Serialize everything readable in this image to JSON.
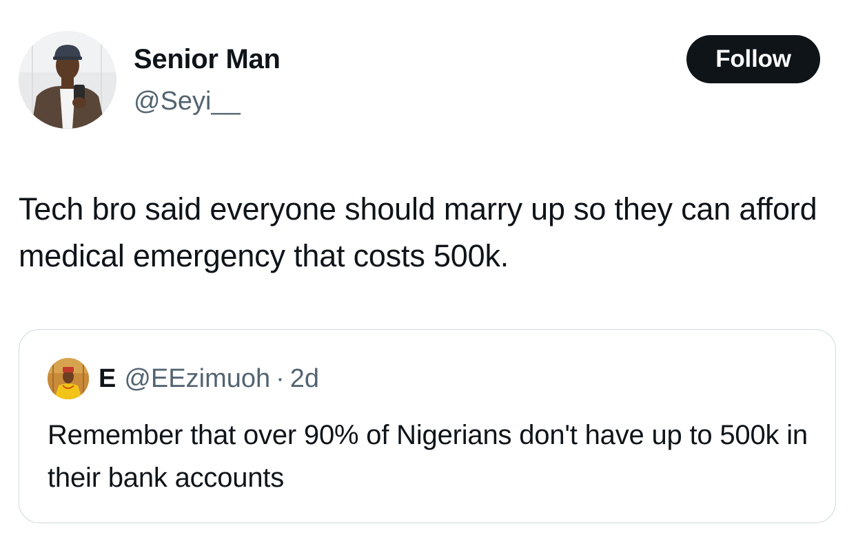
{
  "tweet": {
    "author": {
      "display_name": "Senior Man",
      "handle": "@Seyi__"
    },
    "follow_label": "Follow",
    "text": "Tech bro said everyone should marry up so they can afford medical emergency that costs 500k."
  },
  "quoted_tweet": {
    "author": {
      "display_name": "E",
      "handle": "@EEzimuoh"
    },
    "separator": "·",
    "time": "2d",
    "text": "Remember that over 90% of Nigerians don't have up to 500k in their bank accounts"
  },
  "colors": {
    "text_primary": "#0f1419",
    "text_secondary": "#536471",
    "follow_bg": "#0f1419",
    "border": "#cfd9de"
  }
}
